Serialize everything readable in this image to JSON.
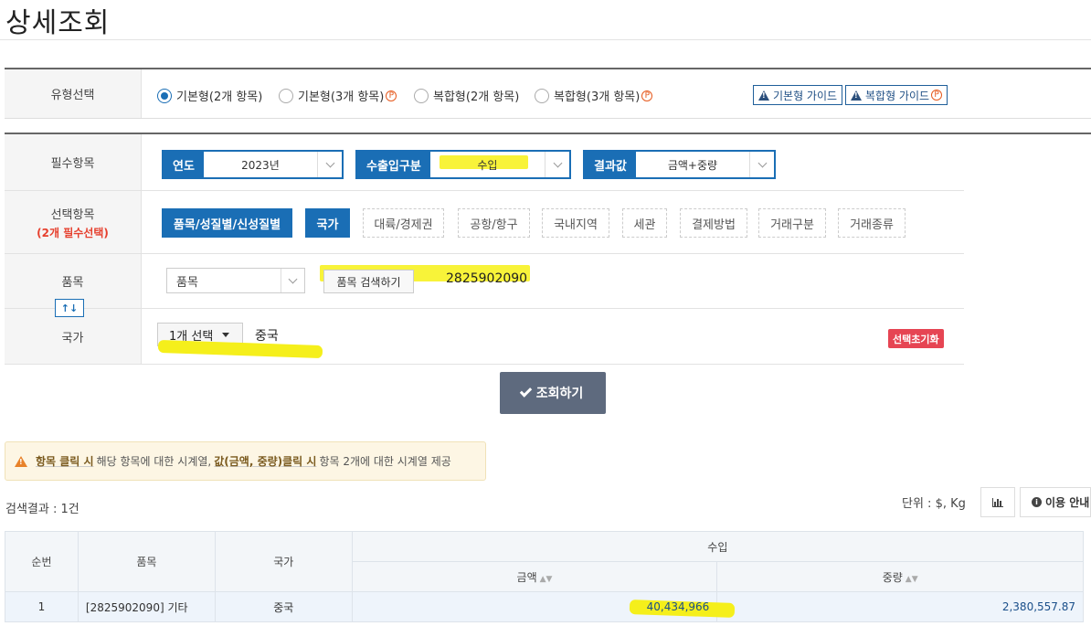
{
  "page": {
    "title": "상세조회"
  },
  "type_select": {
    "label": "유형선택",
    "options": [
      {
        "label": "기본형(2개 항목)",
        "selected": true,
        "premium": false
      },
      {
        "label": "기본형(3개 항목)",
        "selected": false,
        "premium": true
      },
      {
        "label": "복합형(2개 항목)",
        "selected": false,
        "premium": false
      },
      {
        "label": "복합형(3개 항목)",
        "selected": false,
        "premium": true
      }
    ],
    "premium_mark": "P",
    "guide_basic": "기본형 가이드",
    "guide_complex": "복합형 가이드"
  },
  "required": {
    "label": "필수항목",
    "year": {
      "label": "연도",
      "value": "2023년"
    },
    "trade": {
      "label": "수출입구분",
      "value": "수입"
    },
    "result": {
      "label": "결과값",
      "value": "금액+중량"
    }
  },
  "optional": {
    "label": "선택항목",
    "sublabel": "(2개 필수선택)",
    "buttons": [
      {
        "label": "품목/성질별/신성질별",
        "active": true
      },
      {
        "label": "국가",
        "active": true
      },
      {
        "label": "대륙/경제권",
        "active": false
      },
      {
        "label": "공항/항구",
        "active": false
      },
      {
        "label": "국내지역",
        "active": false
      },
      {
        "label": "세관",
        "active": false
      },
      {
        "label": "결제방법",
        "active": false
      },
      {
        "label": "거래구분",
        "active": false
      },
      {
        "label": "거래종류",
        "active": false
      }
    ]
  },
  "item_row": {
    "label": "품목",
    "select_value": "품목",
    "search_button": "품목 검색하기",
    "code": "2825902090",
    "swap_label": "↑↓"
  },
  "country_row": {
    "label": "국가",
    "dropdown": "1개 선택",
    "value": "중국",
    "reset": "선택초기화"
  },
  "search_button": "조회하기",
  "notice": {
    "bold1": "항목 클릭 시",
    "text1": "해당 항목에 대한 시계열,",
    "bold2": "값(금액, 중량)클릭 시",
    "text2": "항목 2개에 대한 시계열 제공"
  },
  "results": {
    "count": "검색결과 : 1건",
    "unit": "단위 : $, Kg",
    "usage_guide": "이용 안내",
    "headers": {
      "no": "순번",
      "item": "품목",
      "country": "국가",
      "group": "수입",
      "amount": "금액",
      "weight": "중량"
    },
    "rows": [
      {
        "no": "1",
        "item": "[2825902090] 기타",
        "country": "중국",
        "amount": "40,434,966",
        "weight": "2,380,557.87"
      }
    ]
  },
  "colors": {
    "primary": "#1a6eb5",
    "danger": "#e64553",
    "search_btn": "#5e6a7e",
    "highlight": "#f7f223"
  }
}
